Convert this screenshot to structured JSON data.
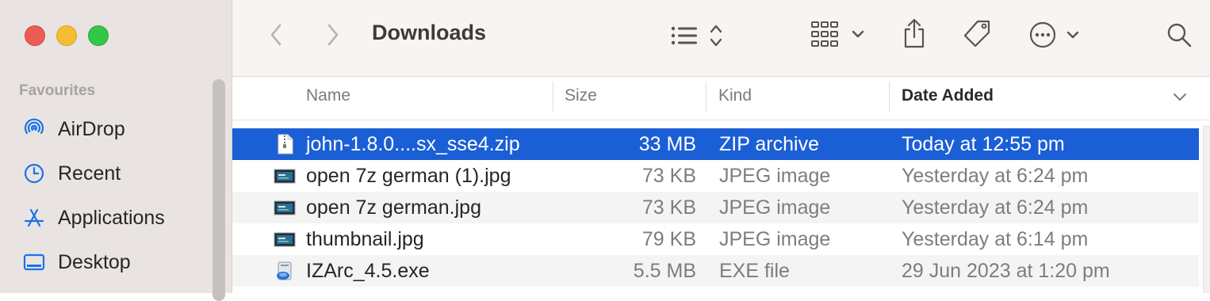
{
  "window": {
    "title": "Downloads"
  },
  "sidebar": {
    "section": "Favourites",
    "items": [
      {
        "label": "AirDrop",
        "icon": "airdrop-icon"
      },
      {
        "label": "Recent",
        "icon": "clock-icon"
      },
      {
        "label": "Applications",
        "icon": "applications-icon"
      },
      {
        "label": "Desktop",
        "icon": "desktop-icon"
      }
    ]
  },
  "toolbar": {
    "back_icon": "chevron-left-icon",
    "forward_icon": "chevron-right-icon",
    "view_icon": "list-view-icon",
    "group_icon": "grid-group-icon",
    "share_icon": "share-icon",
    "tag_icon": "tag-icon",
    "more_icon": "ellipsis-circle-icon",
    "search_icon": "search-icon"
  },
  "columns": {
    "name": "Name",
    "size": "Size",
    "kind": "Kind",
    "date": "Date Added"
  },
  "files": [
    {
      "name": "john-1.8.0....sx_sse4.zip",
      "size": "33 MB",
      "kind": "ZIP archive",
      "date": "Today at 12:55 pm",
      "icon": "zip-file-icon",
      "selected": true
    },
    {
      "name": "open 7z german (1).jpg",
      "size": "73 KB",
      "kind": "JPEG image",
      "date": "Yesterday at 6:24 pm",
      "icon": "image-file-icon",
      "selected": false
    },
    {
      "name": "open 7z german.jpg",
      "size": "73 KB",
      "kind": "JPEG image",
      "date": "Yesterday at 6:24 pm",
      "icon": "image-file-icon",
      "selected": false
    },
    {
      "name": "thumbnail.jpg",
      "size": "79 KB",
      "kind": "JPEG image",
      "date": "Yesterday at 6:14 pm",
      "icon": "image-file-icon",
      "selected": false
    },
    {
      "name": "IZArc_4.5.exe",
      "size": "5.5 MB",
      "kind": "EXE file",
      "date": "29 Jun 2023 at 1:20 pm",
      "icon": "exe-file-icon",
      "selected": false
    }
  ],
  "colors": {
    "selection": "#1b5fd6",
    "accent": "#1a73e8"
  }
}
